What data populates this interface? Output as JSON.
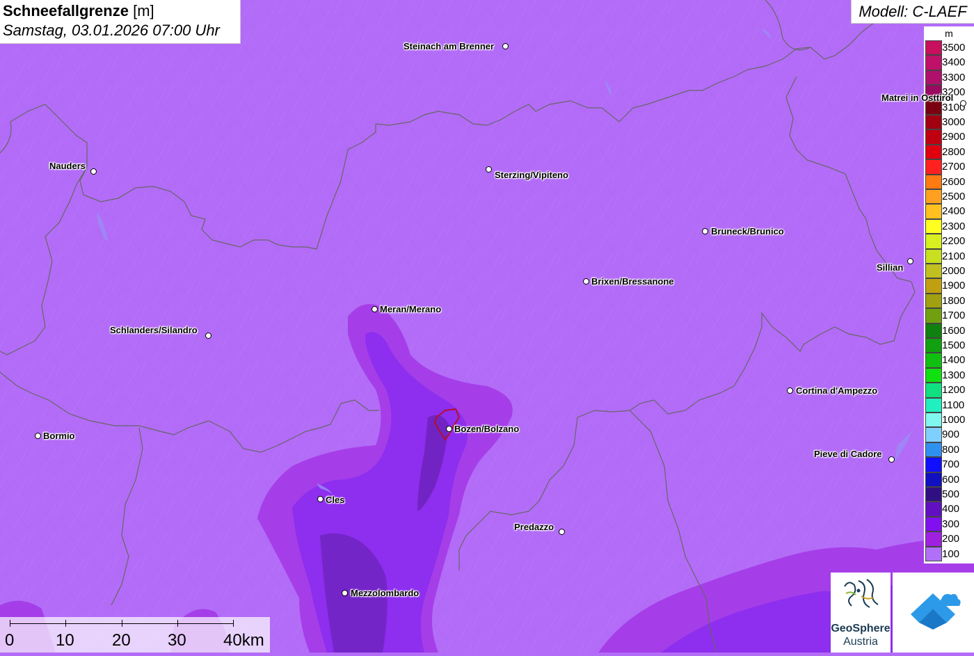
{
  "title": {
    "main_bold": "Schneefallgrenze",
    "main_unit": "[m]",
    "subtitle": "Samstag, 03.01.2026 07:00 Uhr"
  },
  "model_label": "Modell: C-LAEF",
  "legend": {
    "unit": "m",
    "entries": [
      {
        "value": "3500",
        "color": "#c8105e"
      },
      {
        "value": "3400",
        "color": "#c0106a"
      },
      {
        "value": "3300",
        "color": "#b0106c"
      },
      {
        "value": "3200",
        "color": "#9a0a60"
      },
      {
        "value": "3100",
        "color": "#7a0010"
      },
      {
        "value": "3000",
        "color": "#a00010"
      },
      {
        "value": "2900",
        "color": "#c00010"
      },
      {
        "value": "2800",
        "color": "#e00010"
      },
      {
        "value": "2700",
        "color": "#ff2020"
      },
      {
        "value": "2600",
        "color": "#ff7a10"
      },
      {
        "value": "2500",
        "color": "#ffa020"
      },
      {
        "value": "2400",
        "color": "#ffc020"
      },
      {
        "value": "2300",
        "color": "#ffff20"
      },
      {
        "value": "2200",
        "color": "#d8f020"
      },
      {
        "value": "2100",
        "color": "#c8e020"
      },
      {
        "value": "2000",
        "color": "#c0c020"
      },
      {
        "value": "1900",
        "color": "#c0a010"
      },
      {
        "value": "1800",
        "color": "#a0a010"
      },
      {
        "value": "1700",
        "color": "#70a010"
      },
      {
        "value": "1600",
        "color": "#108010"
      },
      {
        "value": "1500",
        "color": "#10a010"
      },
      {
        "value": "1400",
        "color": "#10c010"
      },
      {
        "value": "1300",
        "color": "#10e010"
      },
      {
        "value": "1200",
        "color": "#10e080"
      },
      {
        "value": "1100",
        "color": "#20f0c0"
      },
      {
        "value": "1000",
        "color": "#80f8f0"
      },
      {
        "value": "900",
        "color": "#80d0ff"
      },
      {
        "value": "800",
        "color": "#3090f0"
      },
      {
        "value": "700",
        "color": "#1010ff"
      },
      {
        "value": "600",
        "color": "#1010c0"
      },
      {
        "value": "500",
        "color": "#301080"
      },
      {
        "value": "400",
        "color": "#6010c0"
      },
      {
        "value": "300",
        "color": "#8010f0"
      },
      {
        "value": "200",
        "color": "#a020e0"
      },
      {
        "value": "100",
        "color": "#b070f8"
      }
    ]
  },
  "cities": [
    {
      "name": "Steinach am Brenner",
      "id": "steinach"
    },
    {
      "name": "Nauders",
      "id": "nauders"
    },
    {
      "name": "Sterzing/Vipiteno",
      "id": "sterzing"
    },
    {
      "name": "Matrei in Osttirol",
      "id": "matrei"
    },
    {
      "name": "Bruneck/Brunico",
      "id": "bruneck"
    },
    {
      "name": "Sillian",
      "id": "sillian"
    },
    {
      "name": "Brixen/Bressanone",
      "id": "brixen"
    },
    {
      "name": "Meran/Merano",
      "id": "meran"
    },
    {
      "name": "Schlanders/Silandro",
      "id": "schlanders"
    },
    {
      "name": "Cortina d'Ampezzo",
      "id": "cortina"
    },
    {
      "name": "Bormio",
      "id": "bormio"
    },
    {
      "name": "Bozen/Bolzano",
      "id": "bozen"
    },
    {
      "name": "Pieve di Cadore",
      "id": "pieve"
    },
    {
      "name": "Cles",
      "id": "cles"
    },
    {
      "name": "Predazzo",
      "id": "predazzo"
    },
    {
      "name": "Mezzolombardo",
      "id": "mezzolombardo"
    }
  ],
  "scale": {
    "labels": [
      "0",
      "10",
      "20",
      "30",
      "40km"
    ]
  },
  "logos": {
    "geosphere_line1": "GeoSphere",
    "geosphere_line2": "Austria"
  },
  "colors": {
    "background_band": "#b36cf7",
    "band_200": "#a33ae6",
    "band_300": "#8a2cf0",
    "band_400": "#6a22b8",
    "border_lines": "#666666",
    "bozen_outline": "#b0102a"
  }
}
